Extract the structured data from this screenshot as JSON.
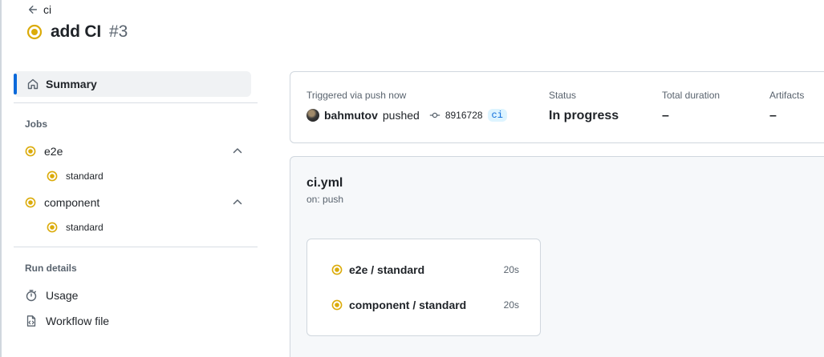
{
  "header": {
    "back_label": "ci",
    "title": "add CI",
    "run_number": "#3"
  },
  "sidebar": {
    "summary_label": "Summary",
    "jobs_heading": "Jobs",
    "jobs": [
      {
        "name": "e2e",
        "status": "in-progress",
        "expanded": true,
        "children": [
          {
            "name": "standard",
            "status": "in-progress"
          }
        ]
      },
      {
        "name": "component",
        "status": "in-progress",
        "expanded": true,
        "children": [
          {
            "name": "standard",
            "status": "in-progress"
          }
        ]
      }
    ],
    "run_details_heading": "Run details",
    "run_details": [
      {
        "label": "Usage",
        "icon": "stopwatch-icon"
      },
      {
        "label": "Workflow file",
        "icon": "file-code-icon"
      }
    ]
  },
  "summary": {
    "trigger_label": "Triggered via push now",
    "actor": "bahmutov",
    "action": "pushed",
    "commit_sha": "8916728",
    "branch": "ci",
    "status_label": "Status",
    "status_value": "In progress",
    "duration_label": "Total duration",
    "duration_value": "–",
    "artifacts_label": "Artifacts",
    "artifacts_value": "–"
  },
  "workflow": {
    "file_name": "ci.yml",
    "trigger": "on: push",
    "jobs": [
      {
        "name": "e2e / standard",
        "time": "20s",
        "status": "in-progress"
      },
      {
        "name": "component / standard",
        "time": "20s",
        "status": "in-progress"
      }
    ]
  },
  "colors": {
    "in_progress": "#dbab0a",
    "accent": "#0969da",
    "border": "#d0d7de",
    "muted_text": "#59636e"
  }
}
